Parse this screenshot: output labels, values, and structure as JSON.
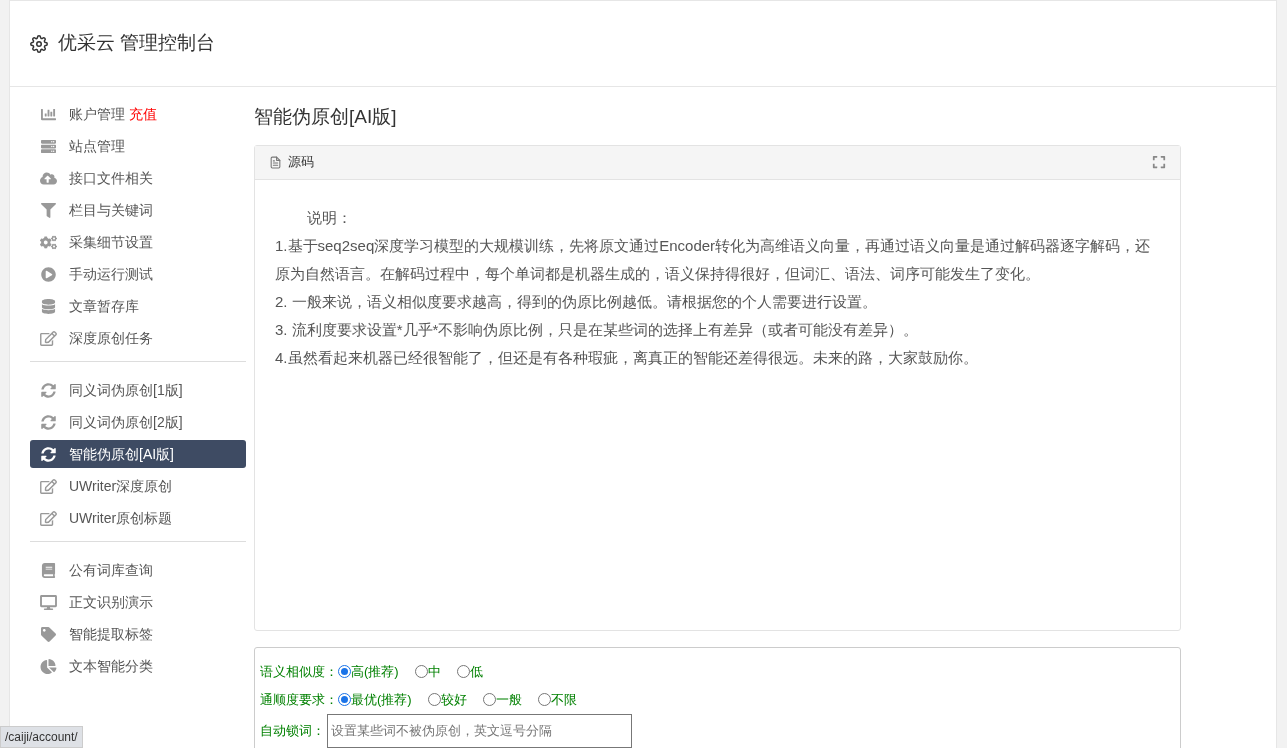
{
  "header": {
    "title": "优采云 管理控制台"
  },
  "sidebar": {
    "groups": [
      {
        "items": [
          {
            "label": "账户管理",
            "badge": "充值",
            "selected": false
          },
          {
            "label": "站点管理",
            "selected": false
          },
          {
            "label": "接口文件相关",
            "selected": false
          },
          {
            "label": "栏目与关键词",
            "selected": false
          },
          {
            "label": "采集细节设置",
            "selected": false
          },
          {
            "label": "手动运行测试",
            "selected": false
          },
          {
            "label": "文章暂存库",
            "selected": false
          },
          {
            "label": "深度原创任务",
            "selected": false
          }
        ]
      },
      {
        "items": [
          {
            "label": "同义词伪原创[1版]",
            "selected": false
          },
          {
            "label": "同义词伪原创[2版]",
            "selected": false
          },
          {
            "label": "智能伪原创[AI版]",
            "selected": true
          },
          {
            "label": "UWriter深度原创",
            "selected": false
          },
          {
            "label": "UWriter原创标题",
            "selected": false
          }
        ]
      },
      {
        "items": [
          {
            "label": "公有词库查询",
            "selected": false
          },
          {
            "label": "正文识别演示",
            "selected": false
          },
          {
            "label": "智能提取标签",
            "selected": false
          },
          {
            "label": "文本智能分类",
            "selected": false
          }
        ]
      }
    ]
  },
  "main": {
    "title": "智能伪原创[AI版]",
    "panel": {
      "tab": "源码",
      "lines": [
        "说明：",
        "1.基于seq2seq深度学习模型的大规模训练，先将原文通过Encoder转化为高维语义向量，再通过语义向量是通过解码器逐字解码，还原为自然语言。在解码过程中，每个单词都是机器生成的，语义保持得很好，但词汇、语法、词序可能发生了变化。",
        "2. 一般来说，语义相似度要求越高，得到的伪原比例越低。请根据您的个人需要进行设置。",
        "3. 流利度要求设置*几乎*不影响伪原比例，只是在某些词的选择上有差异（或者可能没有差异）。",
        "4.虽然看起来机器已经很智能了，但还是有各种瑕疵，离真正的智能还差得很远。未来的路，大家鼓励你。"
      ]
    },
    "form": {
      "similarity": {
        "label": "语义相似度：",
        "options": [
          {
            "label": "高(推荐)",
            "selected": true
          },
          {
            "label": "中",
            "selected": false
          },
          {
            "label": "低",
            "selected": false
          }
        ]
      },
      "fluency": {
        "label": "通顺度要求：",
        "options": [
          {
            "label": "最优(推荐)",
            "selected": true
          },
          {
            "label": "较好",
            "selected": false
          },
          {
            "label": "一般",
            "selected": false
          },
          {
            "label": "不限",
            "selected": false
          }
        ]
      },
      "lock": {
        "label": "自动锁词：",
        "placeholder": "设置某些词不被伪原创，英文逗号分隔"
      }
    }
  },
  "status_url": "/caiji/account/"
}
